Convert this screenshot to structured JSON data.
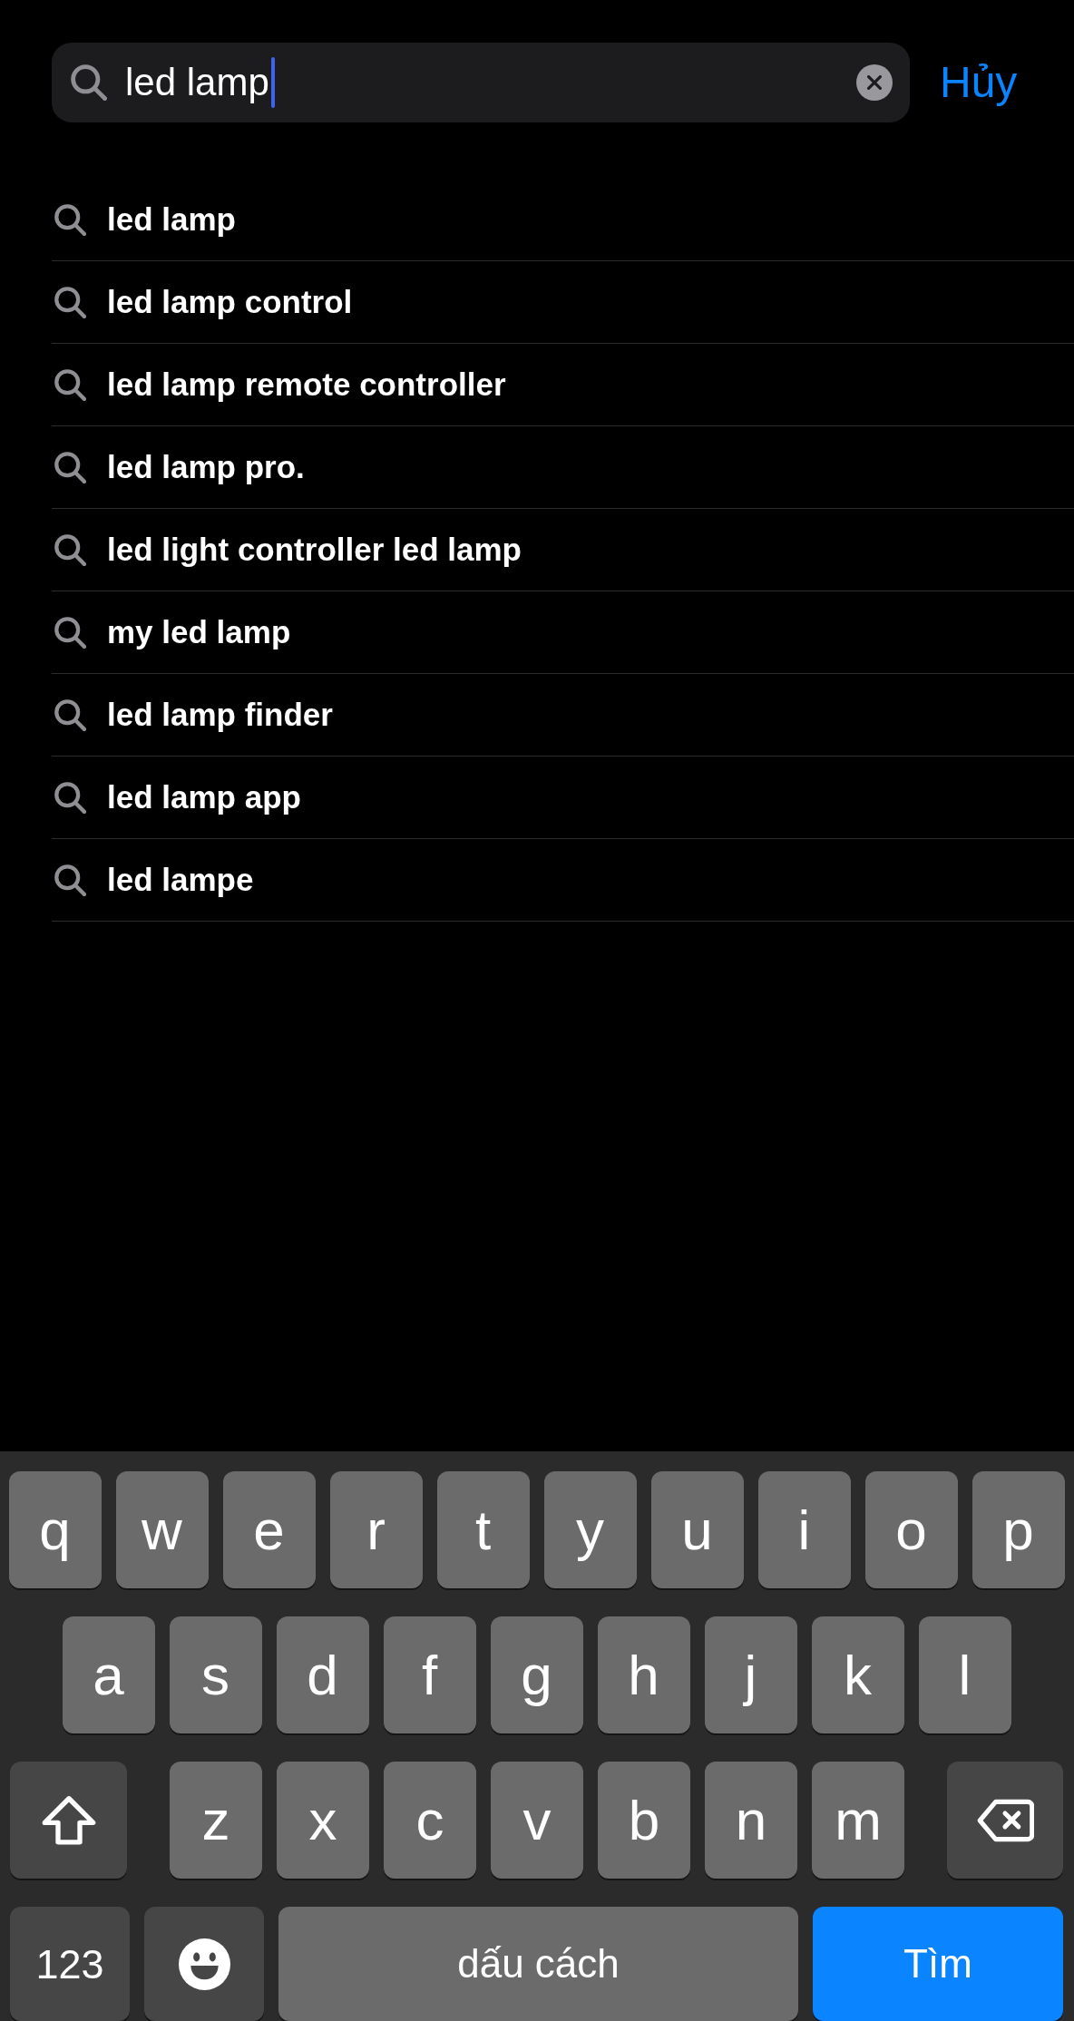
{
  "search_bar": {
    "value": "led lamp",
    "cancel": "Hủy"
  },
  "suggestions": [
    "led lamp",
    "led lamp control",
    "led lamp remote controller",
    "led lamp pro.",
    "led light controller led lamp",
    "my led lamp",
    "led lamp finder",
    "led lamp app",
    "led lampe"
  ],
  "keyboard": {
    "letter_rows": [
      [
        {
          "kind": "letter",
          "label": "q"
        },
        {
          "kind": "letter",
          "label": "w"
        },
        {
          "kind": "letter",
          "label": "e"
        },
        {
          "kind": "letter",
          "label": "r"
        },
        {
          "kind": "letter",
          "label": "t"
        },
        {
          "kind": "letter",
          "label": "y"
        },
        {
          "kind": "letter",
          "label": "u"
        },
        {
          "kind": "letter",
          "label": "i"
        },
        {
          "kind": "letter",
          "label": "o"
        },
        {
          "kind": "letter",
          "label": "p"
        }
      ],
      [
        {
          "kind": "letter",
          "label": "a"
        },
        {
          "kind": "letter",
          "label": "s"
        },
        {
          "kind": "letter",
          "label": "d"
        },
        {
          "kind": "letter",
          "label": "f"
        },
        {
          "kind": "letter",
          "label": "g"
        },
        {
          "kind": "letter",
          "label": "h"
        },
        {
          "kind": "letter",
          "label": "j"
        },
        {
          "kind": "letter",
          "label": "k"
        },
        {
          "kind": "letter",
          "label": "l"
        }
      ],
      [
        {
          "kind": "shift"
        },
        {
          "kind": "letter",
          "label": "z"
        },
        {
          "kind": "letter",
          "label": "x"
        },
        {
          "kind": "letter",
          "label": "c"
        },
        {
          "kind": "letter",
          "label": "v"
        },
        {
          "kind": "letter",
          "label": "b"
        },
        {
          "kind": "letter",
          "label": "n"
        },
        {
          "kind": "letter",
          "label": "m"
        },
        {
          "kind": "backspace"
        }
      ]
    ],
    "bottom_bar": [
      {
        "kind": "numbers",
        "label": "123"
      },
      {
        "kind": "emoji"
      },
      {
        "kind": "space",
        "label": "dấu cách"
      },
      {
        "kind": "search",
        "label": "Tìm"
      }
    ]
  }
}
